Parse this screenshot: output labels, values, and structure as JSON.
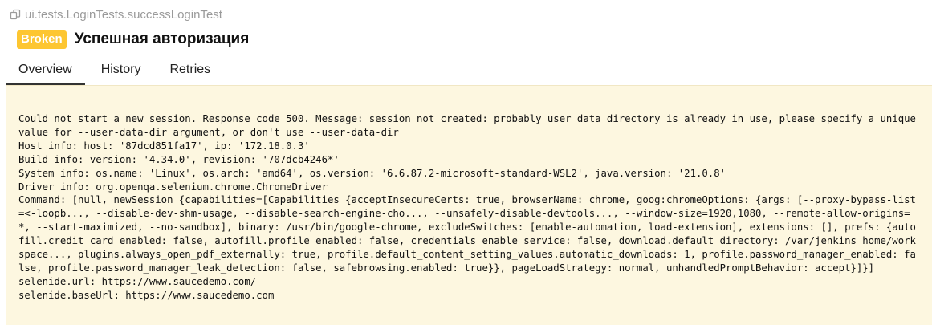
{
  "header": {
    "path": "ui.tests.LoginTests.successLoginTest",
    "status": "Broken",
    "title": "Успешная авторизация"
  },
  "tabs": [
    {
      "label": "Overview",
      "active": true
    },
    {
      "label": "History",
      "active": false
    },
    {
      "label": "Retries",
      "active": false
    }
  ],
  "message": {
    "lines": [
      "Could not start a new session. Response code 500. Message: session not created: probably user data directory is already in use, please specify a unique value for --user-data-dir argument, or don't use --user-data-dir",
      "Host info: host: '87dcd851fa17', ip: '172.18.0.3'",
      "Build info: version: '4.34.0', revision: '707dcb4246*'",
      "System info: os.name: 'Linux', os.arch: 'amd64', os.version: '6.6.87.2-microsoft-standard-WSL2', java.version: '21.0.8'",
      "Driver info: org.openqa.selenium.chrome.ChromeDriver",
      "Command: [null, newSession {capabilities=[Capabilities {acceptInsecureCerts: true, browserName: chrome, goog:chromeOptions: {args: [--proxy-bypass-list=<-loopb..., --disable-dev-shm-usage, --disable-search-engine-cho..., --unsafely-disable-devtools..., --window-size=1920,1080, --remote-allow-origins=*, --start-maximized, --no-sandbox], binary: /usr/bin/google-chrome, excludeSwitches: [enable-automation, load-extension], extensions: [], prefs: {autofill.credit_card_enabled: false, autofill.profile_enabled: false, credentials_enable_service: false, download.default_directory: /var/jenkins_home/workspace..., plugins.always_open_pdf_externally: true, profile.default_content_setting_values.automatic_downloads: 1, profile.password_manager_enabled: false, profile.password_manager_leak_detection: false, safebrowsing.enabled: true}}, pageLoadStrategy: normal, unhandledPromptBehavior: accept}]}]",
      "selenide.url: https://www.saucedemo.com/",
      "selenide.baseUrl: https://www.saucedemo.com"
    ]
  },
  "colors": {
    "broken": "#fdc631",
    "panel_bg": "#fdf7e0"
  },
  "icons": {
    "copy": "copy-icon"
  }
}
